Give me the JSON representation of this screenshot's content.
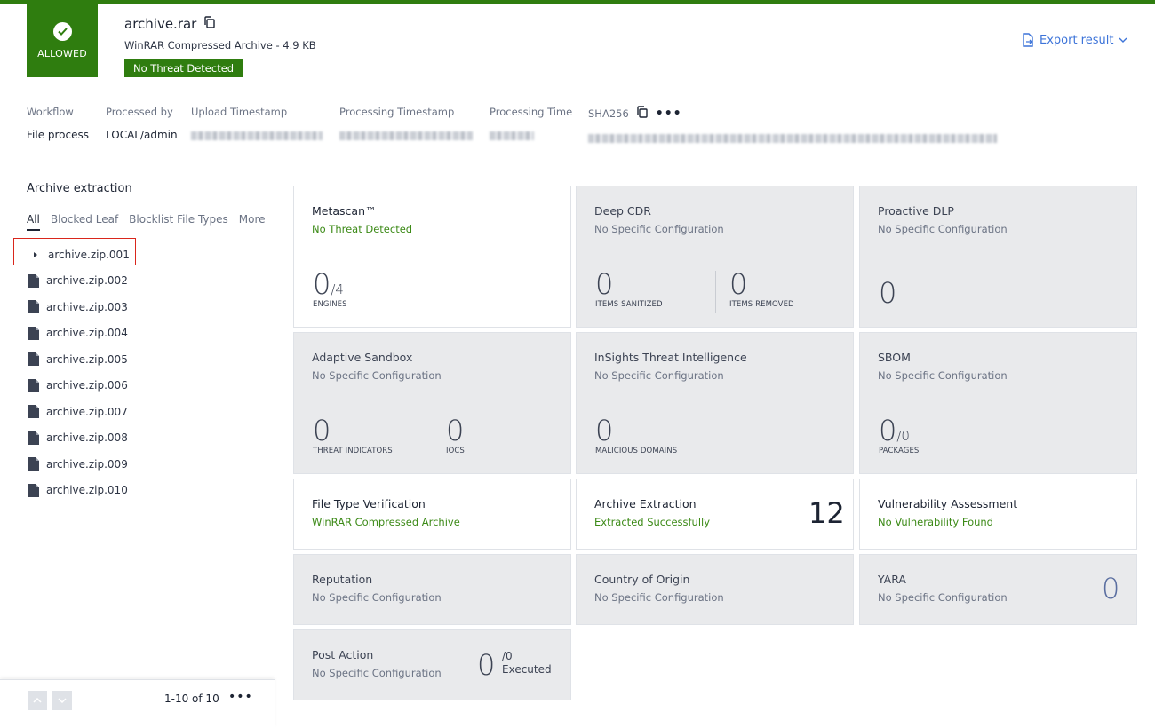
{
  "header": {
    "verdict": "ALLOWED",
    "file_name": "archive.rar",
    "file_type": "WinRAR Compressed Archive - 4.9 KB",
    "badge": "No Threat Detected",
    "export_label": "Export result"
  },
  "meta": {
    "workflow_label": "Workflow",
    "workflow_value": "File process",
    "processed_by_label": "Processed by",
    "processed_by_value": "LOCAL/admin",
    "upload_label": "Upload Timestamp",
    "processing_ts_label": "Processing Timestamp",
    "processing_time_label": "Processing Time",
    "sha_label": "SHA256"
  },
  "sidebar": {
    "title": "Archive extraction",
    "tabs": [
      "All",
      "Blocked Leaf",
      "Blocklist File Types",
      "More"
    ],
    "items": [
      "archive.zip.001",
      "archive.zip.002",
      "archive.zip.003",
      "archive.zip.004",
      "archive.zip.005",
      "archive.zip.006",
      "archive.zip.007",
      "archive.zip.008",
      "archive.zip.009",
      "archive.zip.010"
    ],
    "pager": "1-10 of 10"
  },
  "cards": {
    "metascan": {
      "title": "Metascan™",
      "status": "No Threat Detected",
      "value": "0",
      "total": "/4",
      "caption": "ENGINES"
    },
    "deepcdr": {
      "title": "Deep CDR",
      "status": "No Specific Configuration",
      "v1": "0",
      "c1": "ITEMS SANITIZED",
      "v2": "0",
      "c2": "ITEMS REMOVED"
    },
    "dlp": {
      "title": "Proactive DLP",
      "status": "No Specific Configuration",
      "value": "0"
    },
    "sandbox": {
      "title": "Adaptive Sandbox",
      "status": "No Specific Configuration",
      "v1": "0",
      "c1": "THREAT INDICATORS",
      "v2": "0",
      "c2": "IOCS"
    },
    "insights": {
      "title": "InSights Threat Intelligence",
      "status": "No Specific Configuration",
      "value": "0",
      "caption": "MALICIOUS DOMAINS"
    },
    "sbom": {
      "title": "SBOM",
      "status": "No Specific Configuration",
      "value": "0",
      "total": "/0",
      "caption": "PACKAGES"
    },
    "ftv": {
      "title": "File Type Verification",
      "status": "WinRAR Compressed Archive"
    },
    "extraction": {
      "title": "Archive Extraction",
      "status": "Extracted Successfully",
      "value": "12"
    },
    "vuln": {
      "title": "Vulnerability Assessment",
      "status": "No Vulnerability Found"
    },
    "reputation": {
      "title": "Reputation",
      "status": "No Specific Configuration"
    },
    "country": {
      "title": "Country of Origin",
      "status": "No Specific Configuration"
    },
    "yara": {
      "title": "YARA",
      "status": "No Specific Configuration",
      "value": "0"
    },
    "postaction": {
      "title": "Post Action",
      "status": "No Specific Configuration",
      "value": "0",
      "total": "/0",
      "executed": "Executed"
    }
  },
  "colors": {
    "brand_green": "#2f7d0f",
    "link_blue": "#3d74d9",
    "selection_red": "#d9261c"
  }
}
